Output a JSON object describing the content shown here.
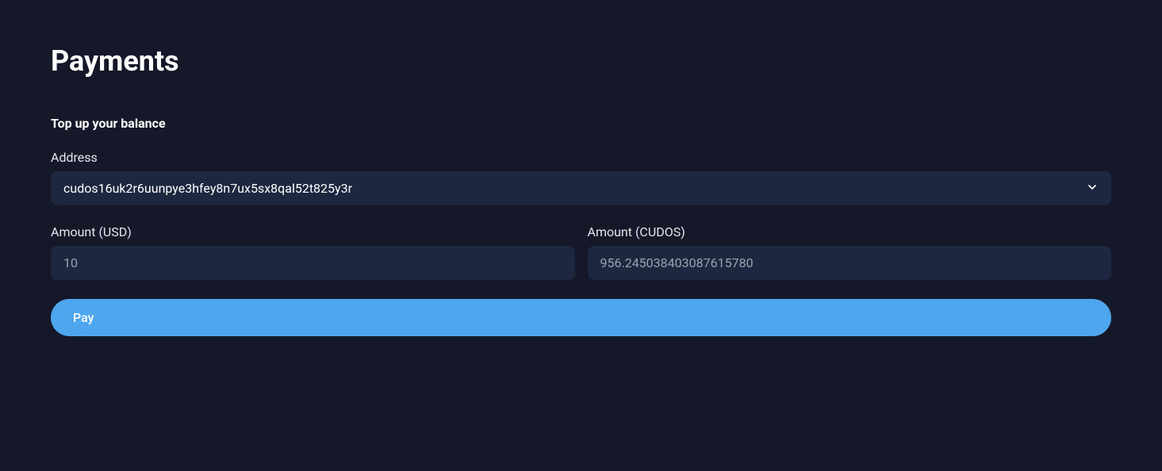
{
  "page": {
    "title": "Payments"
  },
  "topup": {
    "section_title": "Top up your balance",
    "address_label": "Address",
    "address_value": "cudos16uk2r6uunpye3hfey8n7ux5sx8qal52t825y3r",
    "amount_usd_label": "Amount (USD)",
    "amount_usd_placeholder": "10",
    "amount_usd_value": "",
    "amount_cudos_label": "Amount (CUDOS)",
    "amount_cudos_placeholder": "956.245038403087615780",
    "amount_cudos_value": "",
    "pay_button_label": "Pay"
  }
}
